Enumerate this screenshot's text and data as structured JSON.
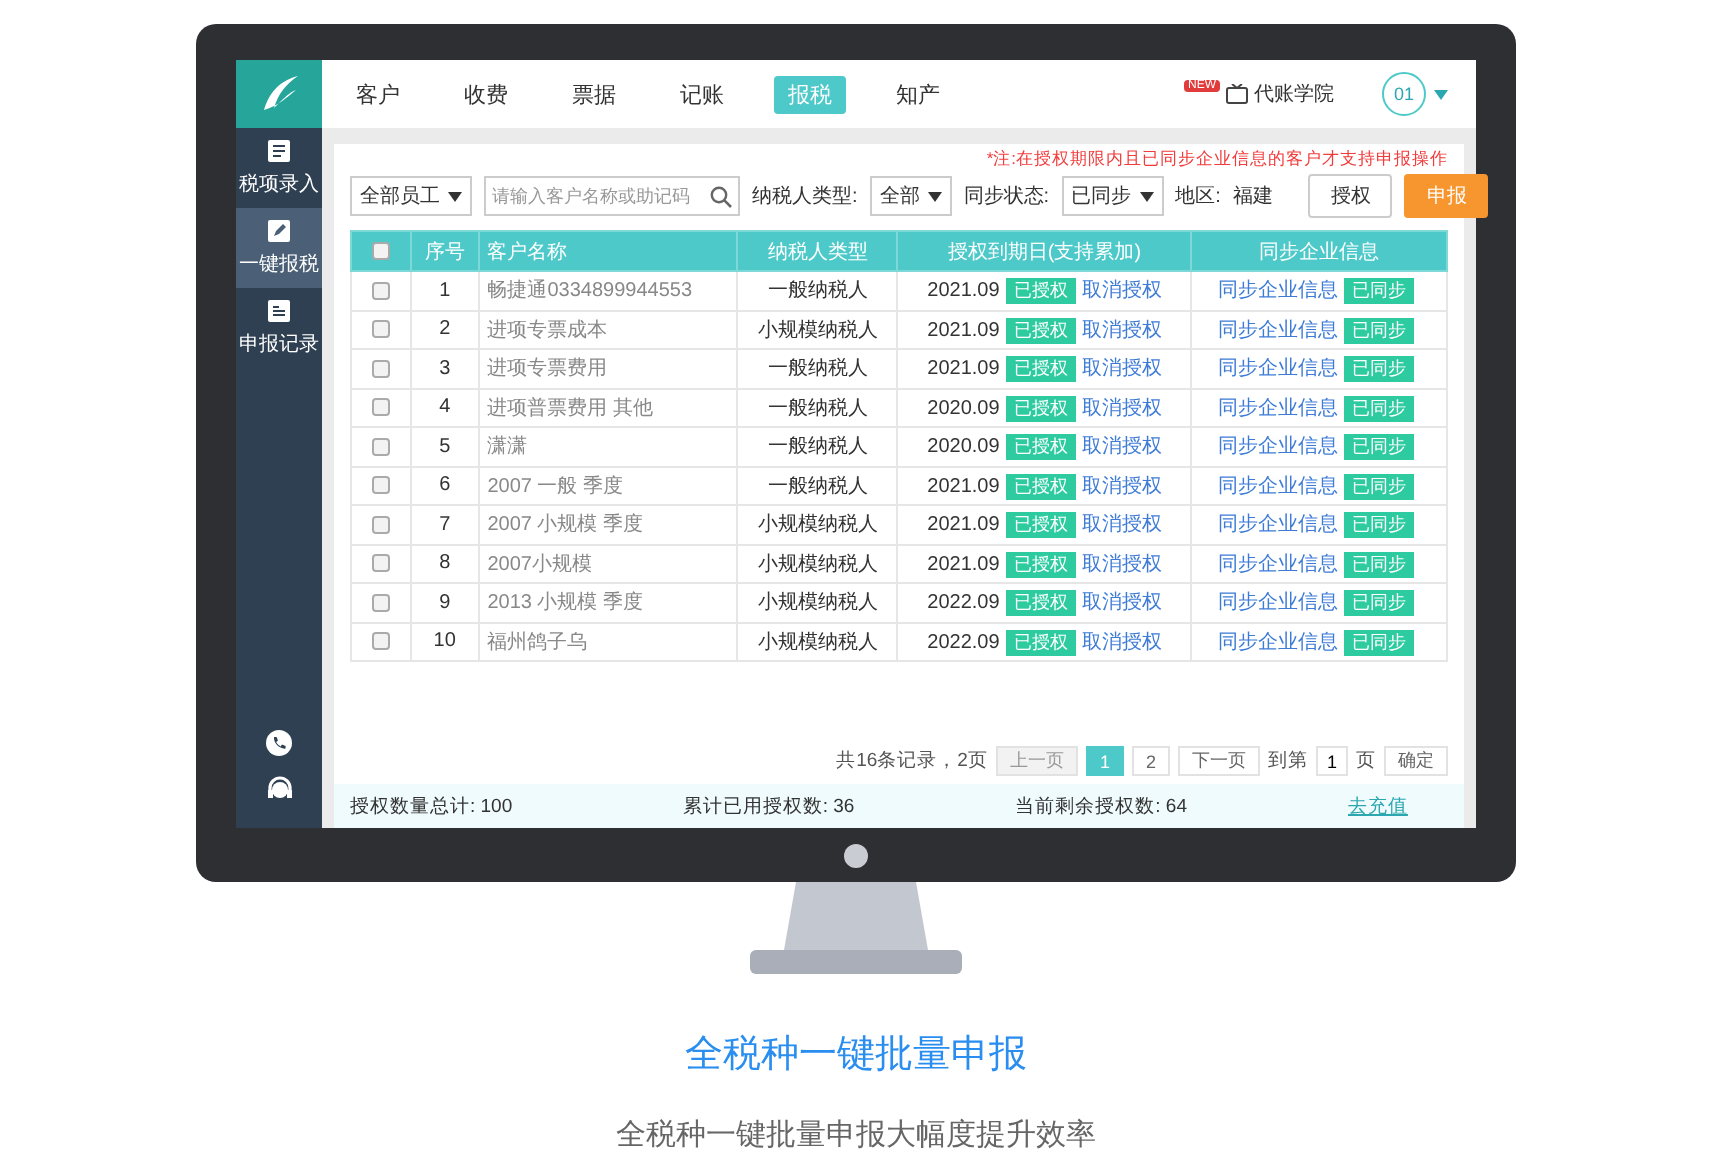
{
  "nav": {
    "tabs": [
      {
        "label": "客户",
        "selected": false
      },
      {
        "label": "收费",
        "selected": false
      },
      {
        "label": "票据",
        "selected": false
      },
      {
        "label": "记账",
        "selected": false
      },
      {
        "label": "报税",
        "selected": true
      },
      {
        "label": "知产",
        "selected": false
      }
    ],
    "academy": {
      "badge": "NEW",
      "label": "代账学院"
    },
    "user": "01"
  },
  "sidebar": {
    "items": [
      {
        "label": "税项录入",
        "selected": false,
        "kind": "entry"
      },
      {
        "label": "一键报税",
        "selected": true,
        "kind": "edit"
      },
      {
        "label": "申报记录",
        "selected": false,
        "kind": "record"
      }
    ]
  },
  "note": "*注:在授权期限内且已同步企业信息的客户才支持申报操作",
  "filters": {
    "employee": "全部员工",
    "search_placeholder": "请输入客户名称或助记码",
    "taxpayer_label": "纳税人类型:",
    "taxpayer_value": "全部",
    "sync_label": "同步状态:",
    "sync_value": "已同步",
    "region_label": "地区:",
    "region_value": "福建",
    "buttons": [
      {
        "label": "授权",
        "kind": "outline"
      },
      {
        "label": "申报",
        "kind": "primary"
      }
    ]
  },
  "table": {
    "columns": [
      "序号",
      "客户名称",
      "纳税人类型",
      "授权到期日(支持累加)",
      "同步企业信息"
    ],
    "header_checked": false,
    "rows": [
      {
        "checked": false,
        "index": "1",
        "name": "畅捷通0334899944553",
        "type": "一般纳税人",
        "expiry": "2021.09",
        "auth": "已授权",
        "cancel": "取消授权",
        "sync_link": "同步企业信息",
        "sync_status": "已同步"
      },
      {
        "checked": false,
        "index": "2",
        "name": "进项专票成本",
        "type": "小规模纳税人",
        "expiry": "2021.09",
        "auth": "已授权",
        "cancel": "取消授权",
        "sync_link": "同步企业信息",
        "sync_status": "已同步"
      },
      {
        "checked": false,
        "index": "3",
        "name": "进项专票费用",
        "type": "一般纳税人",
        "expiry": "2021.09",
        "auth": "已授权",
        "cancel": "取消授权",
        "sync_link": "同步企业信息",
        "sync_status": "已同步"
      },
      {
        "checked": false,
        "index": "4",
        "name": "进项普票费用 其他",
        "type": "一般纳税人",
        "expiry": "2020.09",
        "auth": "已授权",
        "cancel": "取消授权",
        "sync_link": "同步企业信息",
        "sync_status": "已同步"
      },
      {
        "checked": false,
        "index": "5",
        "name": "潇潇",
        "type": "一般纳税人",
        "expiry": "2020.09",
        "auth": "已授权",
        "cancel": "取消授权",
        "sync_link": "同步企业信息",
        "sync_status": "已同步"
      },
      {
        "checked": false,
        "index": "6",
        "name": "2007 一般 季度",
        "type": "一般纳税人",
        "expiry": "2021.09",
        "auth": "已授权",
        "cancel": "取消授权",
        "sync_link": "同步企业信息",
        "sync_status": "已同步"
      },
      {
        "checked": false,
        "index": "7",
        "name": "2007 小规模 季度",
        "type": "小规模纳税人",
        "expiry": "2021.09",
        "auth": "已授权",
        "cancel": "取消授权",
        "sync_link": "同步企业信息",
        "sync_status": "已同步"
      },
      {
        "checked": false,
        "index": "8",
        "name": "2007小规模",
        "type": "小规模纳税人",
        "expiry": "2021.09",
        "auth": "已授权",
        "cancel": "取消授权",
        "sync_link": "同步企业信息",
        "sync_status": "已同步"
      },
      {
        "checked": false,
        "index": "9",
        "name": "2013 小规模 季度",
        "type": "小规模纳税人",
        "expiry": "2022.09",
        "auth": "已授权",
        "cancel": "取消授权",
        "sync_link": "同步企业信息",
        "sync_status": "已同步"
      },
      {
        "checked": false,
        "index": "10",
        "name": "福州鸽子乌",
        "type": "小规模纳税人",
        "expiry": "2022.09",
        "auth": "已授权",
        "cancel": "取消授权",
        "sync_link": "同步企业信息",
        "sync_status": "已同步"
      }
    ]
  },
  "pagination": {
    "summary": "共16条记录，2页",
    "prev": {
      "label": "上一页",
      "disabled": true
    },
    "pages": [
      {
        "label": "1",
        "selected": true
      },
      {
        "label": "2",
        "selected": false
      }
    ],
    "next": {
      "label": "下一页",
      "disabled": false
    },
    "goto_label": "到第",
    "goto_value": "1",
    "page_unit": "页",
    "confirm": "确定"
  },
  "footer": {
    "stats": [
      "授权数量总计: 100",
      "累计已用授权数: 36",
      "当前剩余授权数: 64"
    ],
    "link": "去充值"
  },
  "caption": {
    "title": "全税种一键批量申报",
    "subtitle": "全税种一键批量申报大幅度提升效率"
  }
}
